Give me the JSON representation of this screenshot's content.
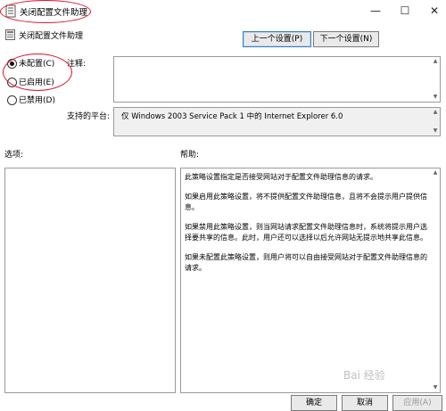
{
  "window": {
    "title": "关闭配置文件助理",
    "minimize_glyph": "—",
    "maximize_glyph": "☐",
    "close_glyph": "✕"
  },
  "header": {
    "setting_name": "关闭配置文件助理",
    "prev_button": "上一个设置(P)",
    "next_button": "下一个设置(N)"
  },
  "state_options": [
    {
      "label": "未配置(C)",
      "checked": true
    },
    {
      "label": "已启用(E)",
      "checked": false
    },
    {
      "label": "已禁用(D)",
      "checked": false
    }
  ],
  "comment": {
    "label": "注释:",
    "value": ""
  },
  "platform": {
    "label": "支持的平台:",
    "value": "仅 Windows 2003 Service Pack 1 中的 Internet Explorer 6.0"
  },
  "options": {
    "label": "选项:"
  },
  "help": {
    "label": "帮助:",
    "paragraphs": [
      "此策略设置指定是否接受网站对于配置文件助理信息的请求。",
      "如果启用此策略设置，将不提供配置文件助理信息，且将不会提示用户提供信息。",
      "如果禁用此策略设置，则当网站请求配置文件助理信息时，系统将提示用户选择要共享的信息。此时，用户还可以选择以后允许网站无提示地共享此信息。",
      "如果未配置此策略设置，则用户将可以自由接受网站对于配置文件助理信息的请求。"
    ]
  },
  "footer": {
    "ok_button": "确定",
    "cancel_button": "取消",
    "apply_button": "应用(A)"
  },
  "watermark": {
    "text": "Bai 经验"
  },
  "colors": {
    "annotation": "#e0142a",
    "focus_border": "#3c7fb1"
  }
}
